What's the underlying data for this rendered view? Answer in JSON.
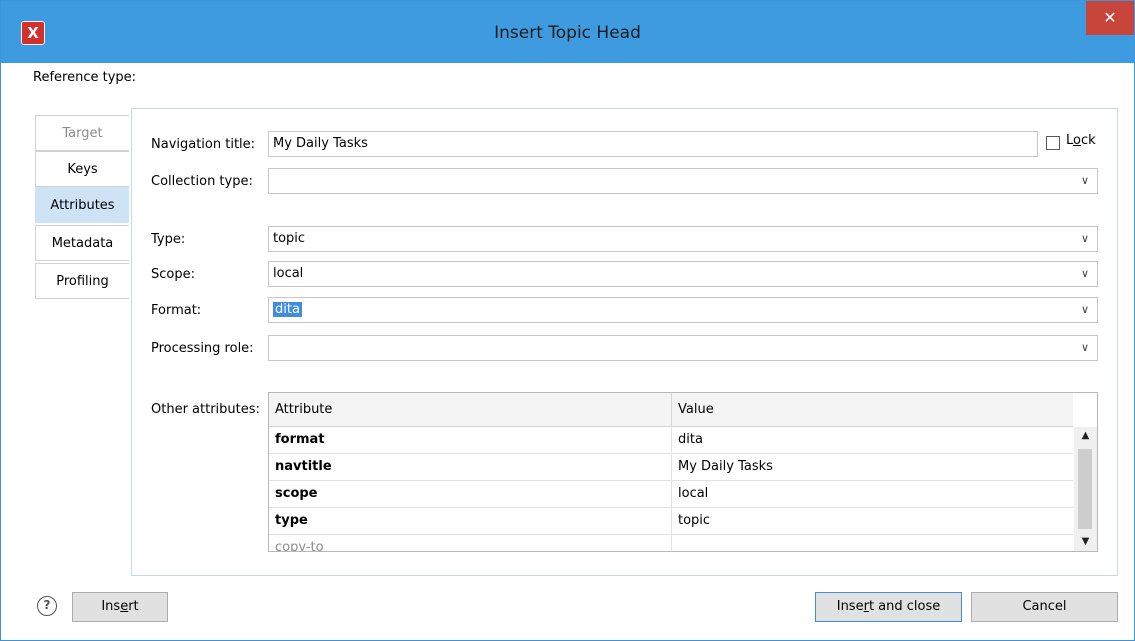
{
  "window": {
    "title": "Insert Topic Head",
    "close_glyph": "✕",
    "app_icon": "oxygen-logo-icon"
  },
  "reference_type_label": "Reference type:",
  "tabs": [
    {
      "label": "Target",
      "state": "disabled"
    },
    {
      "label": "Keys",
      "state": "normal"
    },
    {
      "label": "Attributes",
      "state": "active"
    },
    {
      "label": "Metadata",
      "state": "normal"
    },
    {
      "label": "Profiling",
      "state": "normal"
    }
  ],
  "fields": {
    "navigation_title": {
      "label": "Navigation title:",
      "value": "My Daily Tasks"
    },
    "lock": {
      "label_pre": "L",
      "label_u": "o",
      "label_post": "ck",
      "checked": false
    },
    "collection_type": {
      "label": "Collection type:",
      "value": ""
    },
    "type": {
      "label": "Type:",
      "value": "topic"
    },
    "scope": {
      "label": "Scope:",
      "value": "local"
    },
    "format": {
      "label": "Format:",
      "value": "dita"
    },
    "processing_role": {
      "label": "Processing role:",
      "value": ""
    }
  },
  "other_attributes": {
    "label": "Other attributes:",
    "columns": [
      "Attribute",
      "Value"
    ],
    "rows": [
      {
        "attribute": "format",
        "value": "dita"
      },
      {
        "attribute": "navtitle",
        "value": "My Daily Tasks"
      },
      {
        "attribute": "scope",
        "value": "local"
      },
      {
        "attribute": "type",
        "value": "topic"
      },
      {
        "attribute": "copy-to",
        "value": ""
      }
    ]
  },
  "buttons": {
    "help": "?",
    "insert_pre": "Ins",
    "insert_u": "e",
    "insert_post": "rt",
    "insert_close_pre": "Inse",
    "insert_close_u": "r",
    "insert_close_post": "t and close",
    "cancel": "Cancel"
  },
  "colors": {
    "titlebar": "#3e9be0",
    "close": "#c8453c",
    "active_tab": "#cfe3f6",
    "selection": "#3f8ce0"
  }
}
